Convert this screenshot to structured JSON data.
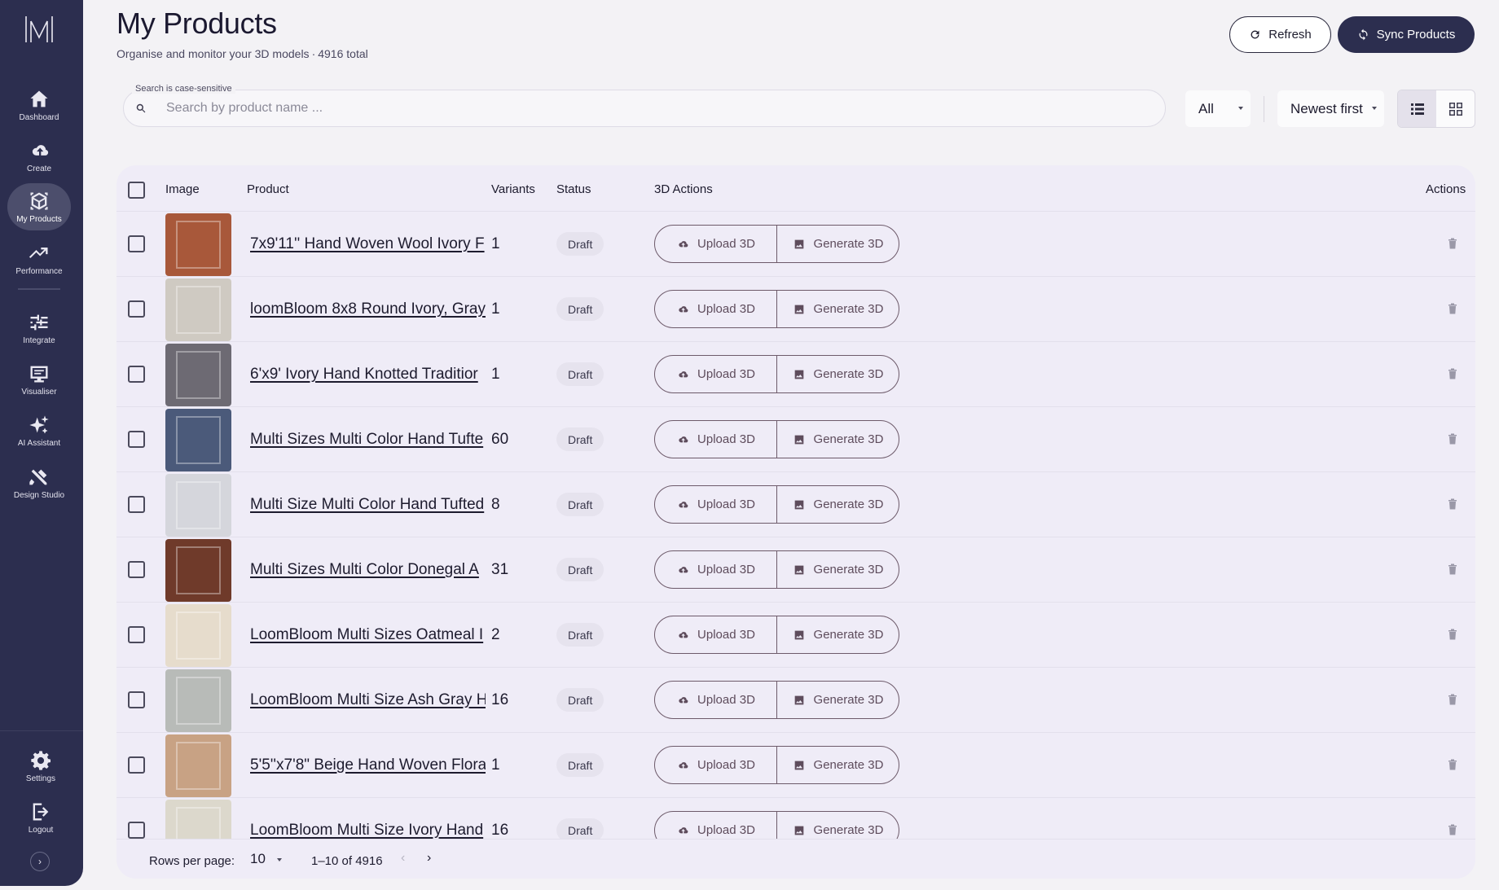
{
  "sidebar": {
    "items": [
      {
        "label": "Dashboard",
        "icon": "home-icon"
      },
      {
        "label": "Create",
        "icon": "cloud-upload-icon"
      },
      {
        "label": "My Products",
        "icon": "cube-icon",
        "active": true
      },
      {
        "label": "Performance",
        "icon": "trending-up-icon"
      },
      {
        "label": "Integrate",
        "icon": "sliders-icon"
      },
      {
        "label": "Visualiser",
        "icon": "monitor-icon"
      },
      {
        "label": "AI Assistant",
        "icon": "sparkles-icon"
      },
      {
        "label": "Design Studio",
        "icon": "design-tools-icon"
      }
    ],
    "bottom": [
      {
        "label": "Settings",
        "icon": "gear-icon"
      },
      {
        "label": "Logout",
        "icon": "logout-icon"
      }
    ],
    "expand_label": "›"
  },
  "header": {
    "title": "My Products",
    "subtitle_main": "Organise and monitor your 3D models",
    "subtitle_sep": "·",
    "subtitle_total": "4916 total",
    "refresh_label": "Refresh",
    "sync_label": "Sync Products"
  },
  "search": {
    "label": "Search is case-sensitive",
    "placeholder": "Search by product name ...",
    "value": ""
  },
  "filters": {
    "status_selected": "All",
    "sort_selected": "Newest first",
    "view_mode": "list"
  },
  "table": {
    "columns": {
      "image": "Image",
      "product": "Product",
      "variants": "Variants",
      "status": "Status",
      "actions_3d": "3D Actions",
      "actions": "Actions"
    },
    "upload_label": "Upload 3D",
    "generate_label": "Generate 3D",
    "rows": [
      {
        "name": "7x9'11'' Hand Woven Wool Ivory F",
        "variants": "1",
        "status": "Draft",
        "thumb": "#a8583a"
      },
      {
        "name": "loomBloom 8x8 Round Ivory, Gray",
        "variants": "1",
        "status": "Draft",
        "thumb": "#cfcac2"
      },
      {
        "name": "6'x9' Ivory Hand Knotted Traditior",
        "variants": "1",
        "status": "Draft",
        "thumb": "#6d6a73"
      },
      {
        "name": "Multi Sizes Multi Color Hand Tufte",
        "variants": "60",
        "status": "Draft",
        "thumb": "#4b5a7a"
      },
      {
        "name": "Multi Size Multi Color Hand Tufted",
        "variants": "8",
        "status": "Draft",
        "thumb": "#d5d6dc"
      },
      {
        "name": "Multi Sizes Multi Color Donegal A",
        "variants": "31",
        "status": "Draft",
        "thumb": "#6f3a2a"
      },
      {
        "name": "LoomBloom Multi Sizes Oatmeal I",
        "variants": "2",
        "status": "Draft",
        "thumb": "#e6dccc"
      },
      {
        "name": "LoomBloom Multi Size Ash Gray H",
        "variants": "16",
        "status": "Draft",
        "thumb": "#b8bbb8"
      },
      {
        "name": "5'5''x7'8\" Beige Hand Woven Flora",
        "variants": "1",
        "status": "Draft",
        "thumb": "#c8a284"
      },
      {
        "name": "LoomBloom Multi Size Ivory Hand",
        "variants": "16",
        "status": "Draft",
        "thumb": "#dcd8cc"
      }
    ]
  },
  "pagination": {
    "rows_per_page_label": "Rows per page:",
    "rows_per_page": "10",
    "range": "1–10 of 4916",
    "prev": "‹",
    "next": "›"
  },
  "colors": {
    "sidebar_bg": "#2c2e4f",
    "sync_bg": "#2c2e4f",
    "table_bg": "#efecf7",
    "accent_button": "#6d5a6a"
  }
}
